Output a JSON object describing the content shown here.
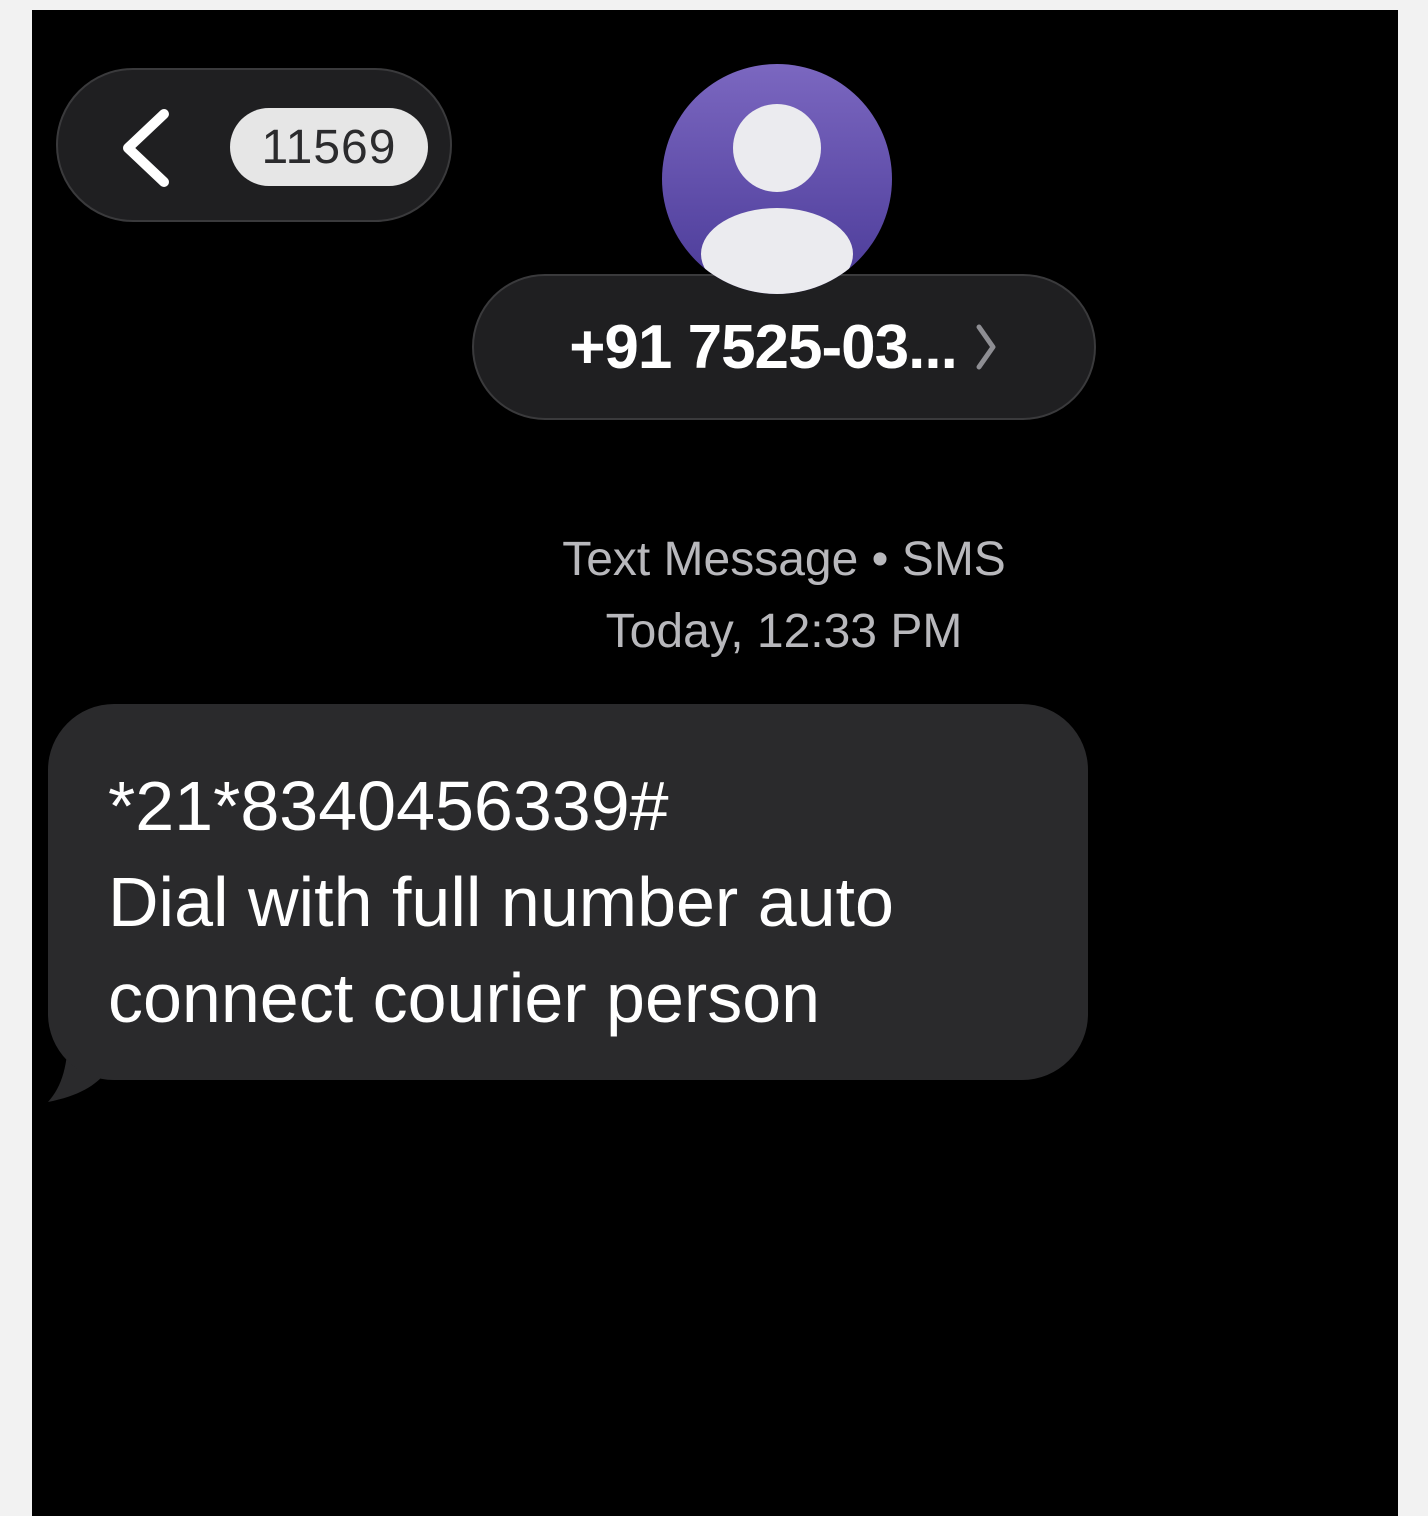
{
  "header": {
    "back_icon": "chevron-left-icon",
    "badge_count": "11569",
    "avatar_icon": "person-icon",
    "contact_name": "+91 7525-03...",
    "contact_chevron_icon": "chevron-right-icon",
    "avatar_color": "#5b4aa8"
  },
  "meta": {
    "channel": "Text Message • SMS",
    "timestamp": "Today, 12:33 PM"
  },
  "messages": [
    {
      "direction": "incoming",
      "lines": [
        "*21*8340456339#",
        "Dial with full number auto",
        "connect courier person"
      ]
    }
  ],
  "colors": {
    "background": "#000000",
    "bubble": "#2a2a2c",
    "pill": "#1f1f21",
    "meta_text": "#b8b8bc"
  }
}
